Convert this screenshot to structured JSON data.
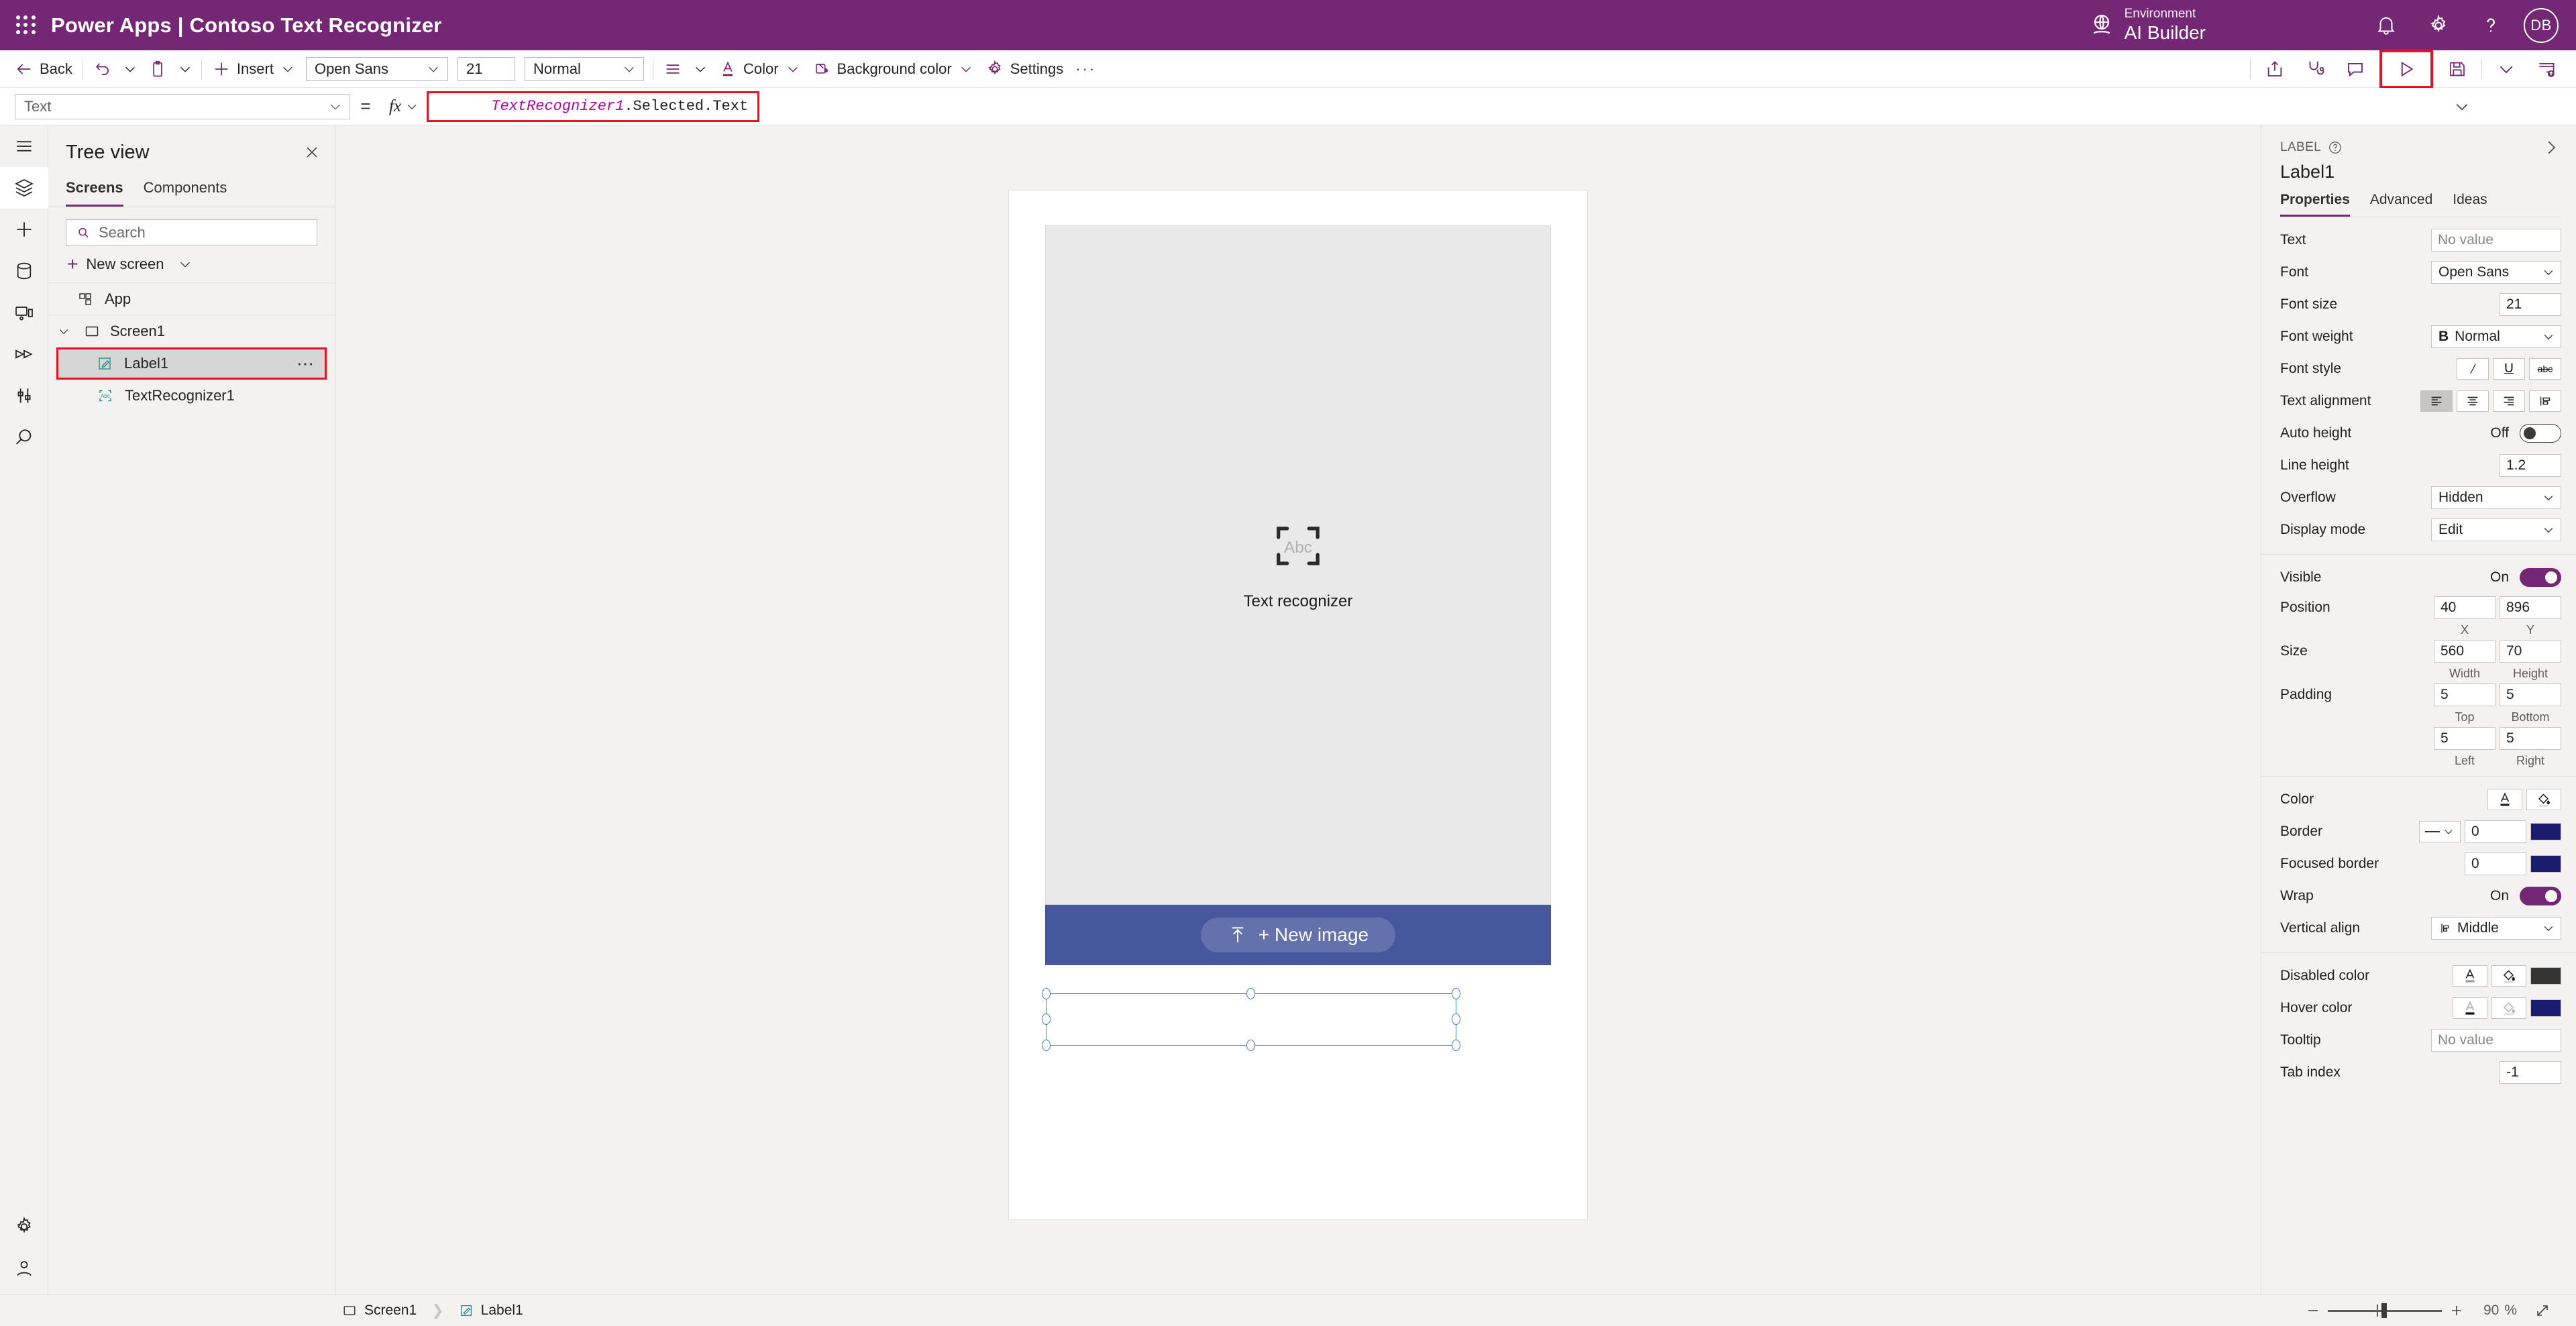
{
  "topbar": {
    "waffle_icon": "waffle-grid-icon",
    "product": "Power Apps",
    "separator": "|",
    "app_name": "Contoso Text Recognizer",
    "title": "Power Apps  |  Contoso Text Recognizer",
    "environment_label": "Environment",
    "environment_name": "AI Builder",
    "icons": [
      "globe-icon",
      "bell-icon",
      "gear-icon",
      "help-icon"
    ],
    "avatar_initials": "DB",
    "background_color": "#742774"
  },
  "ribbon": {
    "back_label": "Back",
    "undo_icon": "undo-icon",
    "paste_icon": "paste-icon",
    "insert_label": "Insert",
    "font_name": "Open Sans",
    "font_size": "21",
    "font_weight": "Normal",
    "align_icon": "text-align-icon",
    "color_label": "Color",
    "background_color_label": "Background color",
    "settings_label": "Settings",
    "overflow_label": "···",
    "right_icons": [
      "share-icon",
      "app-checker-icon",
      "comments-icon",
      "preview-play-icon",
      "save-icon",
      "chevron-down-icon",
      "publish-icon"
    ],
    "highlight_color": "#e81123"
  },
  "formula_bar": {
    "property_selected": "Text",
    "equals": "=",
    "fx_label": "fx",
    "formula_identifier": "TextRecognizer1",
    "formula_rest": ".Selected.Text",
    "formula_full": "TextRecognizer1.Selected.Text",
    "highlight_color": "#e81123",
    "expand_icon": "chevron-down-icon"
  },
  "rail": {
    "items": [
      {
        "name": "hamburger-menu-icon",
        "active": false
      },
      {
        "name": "tree-view-icon",
        "active": true
      },
      {
        "name": "insert-icon",
        "active": false
      },
      {
        "name": "data-icon",
        "active": false
      },
      {
        "name": "media-icon",
        "active": false
      },
      {
        "name": "power-automate-icon",
        "active": false
      },
      {
        "name": "variables-icon",
        "active": false
      },
      {
        "name": "search-icon",
        "active": false
      }
    ],
    "bottom_items": [
      {
        "name": "settings-gear-icon"
      },
      {
        "name": "account-icon"
      }
    ]
  },
  "treeview": {
    "title": "Tree view",
    "close_icon": "close-icon",
    "tabs": [
      {
        "label": "Screens",
        "active": true
      },
      {
        "label": "Components",
        "active": false
      }
    ],
    "search_placeholder": "Search",
    "new_screen_label": "New screen",
    "nodes": [
      {
        "label": "App",
        "icon": "app-icon",
        "selected": false,
        "level": 0
      },
      {
        "label": "Screen1",
        "icon": "screen-icon",
        "selected": false,
        "level": 0,
        "expanded": true
      },
      {
        "label": "Label1",
        "icon": "label-icon",
        "selected": true,
        "level": 1,
        "more_icon": "more-options-icon"
      },
      {
        "label": "TextRecognizer1",
        "icon": "text-recognizer-icon",
        "selected": false,
        "level": 1
      }
    ],
    "highlight_color": "#e81123"
  },
  "canvas": {
    "text_recognizer": {
      "placeholder_icon": "abc-scan-icon",
      "placeholder_glyph": "Abc",
      "caption": "Text recognizer",
      "background_color": "#e9e9e9"
    },
    "new_image_button": {
      "label": "+ New image",
      "upload_icon": "upload-icon",
      "bar_color": "#46579e"
    },
    "selected_control": {
      "name": "Label1",
      "selection_color": "#4a7ebb"
    }
  },
  "properties": {
    "kind": "LABEL",
    "help_icon": "help-circle-icon",
    "collapse_icon": "chevron-right-icon",
    "control_name": "Label1",
    "tabs": [
      {
        "label": "Properties",
        "active": true
      },
      {
        "label": "Advanced",
        "active": false
      },
      {
        "label": "Ideas",
        "active": false
      }
    ],
    "rows": {
      "text": {
        "label": "Text",
        "value": "No value",
        "is_placeholder": true
      },
      "font": {
        "label": "Font",
        "value": "Open Sans"
      },
      "font_size": {
        "label": "Font size",
        "value": "21"
      },
      "font_weight": {
        "label": "Font weight",
        "value": "Normal",
        "prefix_icon": "bold-icon"
      },
      "font_style": {
        "label": "Font style",
        "buttons": [
          "italic-icon",
          "underline-icon",
          "strikethrough-icon"
        ]
      },
      "text_alignment": {
        "label": "Text alignment",
        "buttons": [
          "align-left-icon",
          "align-center-icon",
          "align-right-icon",
          "align-justify-icon"
        ],
        "selected_index": 0
      },
      "auto_height": {
        "label": "Auto height",
        "state": "Off",
        "on": false
      },
      "line_height": {
        "label": "Line height",
        "value": "1.2"
      },
      "overflow": {
        "label": "Overflow",
        "value": "Hidden"
      },
      "display_mode": {
        "label": "Display mode",
        "value": "Edit"
      },
      "visible": {
        "label": "Visible",
        "state": "On",
        "on": true
      },
      "position": {
        "label": "Position",
        "x": "40",
        "y": "896",
        "sub_x": "X",
        "sub_y": "Y"
      },
      "size": {
        "label": "Size",
        "width": "560",
        "height": "70",
        "sub_w": "Width",
        "sub_h": "Height"
      },
      "padding": {
        "label": "Padding",
        "top": "5",
        "bottom": "5",
        "left": "5",
        "right": "5",
        "sub_top": "Top",
        "sub_bottom": "Bottom",
        "sub_left": "Left",
        "sub_right": "Right"
      },
      "color": {
        "label": "Color",
        "font_icon": "font-color-icon",
        "fill_icon": "fill-color-icon"
      },
      "border": {
        "label": "Border",
        "style_icon": "border-style-icon",
        "width": "0",
        "swatch": "#1a1a6e"
      },
      "focused_border": {
        "label": "Focused border",
        "width": "0",
        "swatch": "#1a1a6e"
      },
      "wrap": {
        "label": "Wrap",
        "state": "On",
        "on": true
      },
      "vertical_align": {
        "label": "Vertical align",
        "value": "Middle",
        "prefix_icon": "vertical-align-middle-icon"
      },
      "disabled_color": {
        "label": "Disabled color",
        "font_icon": "font-color-icon",
        "fill_icon": "fill-color-icon",
        "swatch": "#333333"
      },
      "hover_color": {
        "label": "Hover color",
        "font_icon": "font-color-icon",
        "fill_icon": "fill-color-icon",
        "swatch": "#1a1a6e"
      },
      "tooltip": {
        "label": "Tooltip",
        "value": "No value",
        "is_placeholder": true
      },
      "tab_index": {
        "label": "Tab index",
        "value": "-1"
      }
    }
  },
  "statusbar": {
    "breadcrumb": [
      {
        "label": "Screen1",
        "icon": "screen-icon"
      },
      {
        "label": "Label1",
        "icon": "label-icon"
      }
    ],
    "zoom_out_icon": "minus-icon",
    "zoom_in_icon": "plus-icon",
    "zoom_value": "90",
    "zoom_unit": "%",
    "fit_icon": "fit-screen-icon"
  }
}
